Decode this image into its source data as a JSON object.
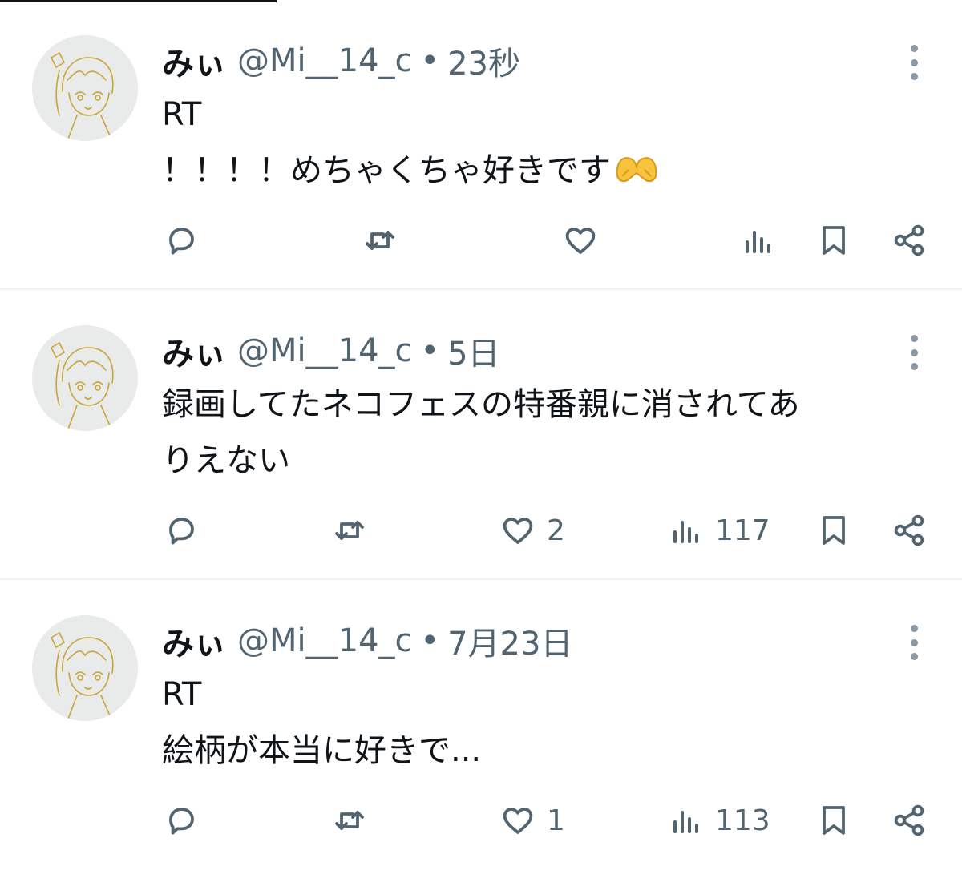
{
  "tweets": [
    {
      "name": "みぃ",
      "handle": "@Mi__14_c",
      "separator": "•",
      "time": "23秒",
      "lines": [
        "RT",
        "！！！！めちゃくちゃ好きです"
      ],
      "emoji": "heart-hands-emoji",
      "likes": "",
      "views": ""
    },
    {
      "name": "みぃ",
      "handle": "@Mi__14_c",
      "separator": "•",
      "time": "5日",
      "lines": [
        "録画してたネコフェスの特番親に消されてあ",
        "りえない"
      ],
      "likes": "2",
      "views": "117"
    },
    {
      "name": "みぃ",
      "handle": "@Mi__14_c",
      "separator": "•",
      "time": "7月23日",
      "lines": [
        "RT",
        "絵柄が本当に好きで..."
      ],
      "likes": "1",
      "views": "113"
    }
  ],
  "icons": {
    "reply": "reply-icon",
    "retweet": "retweet-icon",
    "like": "heart-icon",
    "views": "views-icon",
    "bookmark": "bookmark-icon",
    "share": "share-icon",
    "more": "more-icon"
  },
  "colors": {
    "text": "#0f1419",
    "secondary": "#536471",
    "divider": "#eff3f4",
    "avatar_line": "#c9a53a"
  }
}
